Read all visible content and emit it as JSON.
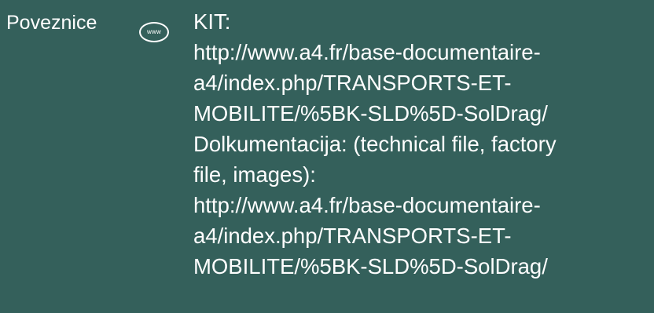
{
  "section": {
    "label": "Poveznice",
    "icon": "www-link-icon",
    "icon_text": "www"
  },
  "content": {
    "lines": [
      "KIT:",
      "http://www.a4.fr/base-documentaire-",
      "a4/index.php/TRANSPORTS-ET-",
      "MOBILITE/%5BK-SLD%5D-SolDrag/",
      "Dolkumentacija: (technical file, factory",
      "file, images):",
      "http://www.a4.fr/base-documentaire-",
      "a4/index.php/TRANSPORTS-ET-",
      "MOBILITE/%5BK-SLD%5D-SolDrag/"
    ]
  },
  "colors": {
    "background": "#34605b",
    "text": "#ffffff"
  }
}
